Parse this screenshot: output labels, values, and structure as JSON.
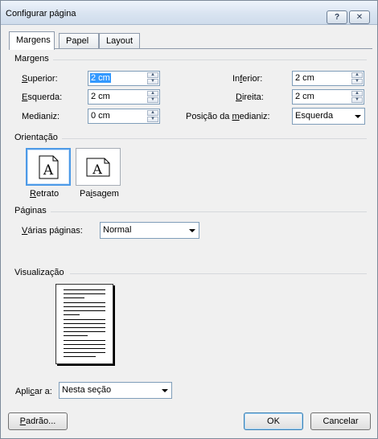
{
  "window": {
    "title": "Configurar página",
    "help_glyph": "?",
    "close_glyph": "✕"
  },
  "tabs": [
    {
      "label": "Margens",
      "active": true
    },
    {
      "label": "Papel",
      "active": false
    },
    {
      "label": "Layout",
      "active": false
    }
  ],
  "margins": {
    "section_title": "Margens",
    "superior": {
      "label_pre": "",
      "label_accel": "S",
      "label_post": "uperior:",
      "value": "2 cm"
    },
    "inferior": {
      "label_pre": "In",
      "label_accel": "f",
      "label_post": "erior:",
      "value": "2 cm"
    },
    "esquerda": {
      "label_pre": "",
      "label_accel": "E",
      "label_post": "squerda:",
      "value": "2 cm"
    },
    "direita": {
      "label_pre": "",
      "label_accel": "D",
      "label_post": "ireita:",
      "value": "2 cm"
    },
    "medianiz": {
      "label_pre": "Medianiz:",
      "value": "0 cm"
    },
    "posicao_medianiz": {
      "label_pre": "Posição da ",
      "label_accel": "m",
      "label_post": "edianiz:",
      "value": "Esquerda"
    }
  },
  "orientation": {
    "section_title": "Orientação",
    "retrato": {
      "label_accel": "R",
      "label_post": "etrato",
      "glyph": "A"
    },
    "paisagem": {
      "label_pre": "Pa",
      "label_accel": "i",
      "label_post": "sagem",
      "glyph": "A"
    }
  },
  "pages": {
    "section_title": "Páginas",
    "multiple_label_pre": "",
    "multiple_label_accel": "V",
    "multiple_label_post": "árias páginas:",
    "multiple_value": "Normal"
  },
  "preview": {
    "section_title": "Visualização"
  },
  "apply": {
    "label_pre": "Apli",
    "label_accel": "c",
    "label_post": "ar a:",
    "value": "Nesta seção"
  },
  "buttons": {
    "default_pre": "",
    "default_accel": "P",
    "default_post": "adrão...",
    "ok": "OK",
    "cancel": "Cancelar"
  },
  "colors": {
    "selection": "#3399ff",
    "accent_border": "#4d9ae7"
  }
}
